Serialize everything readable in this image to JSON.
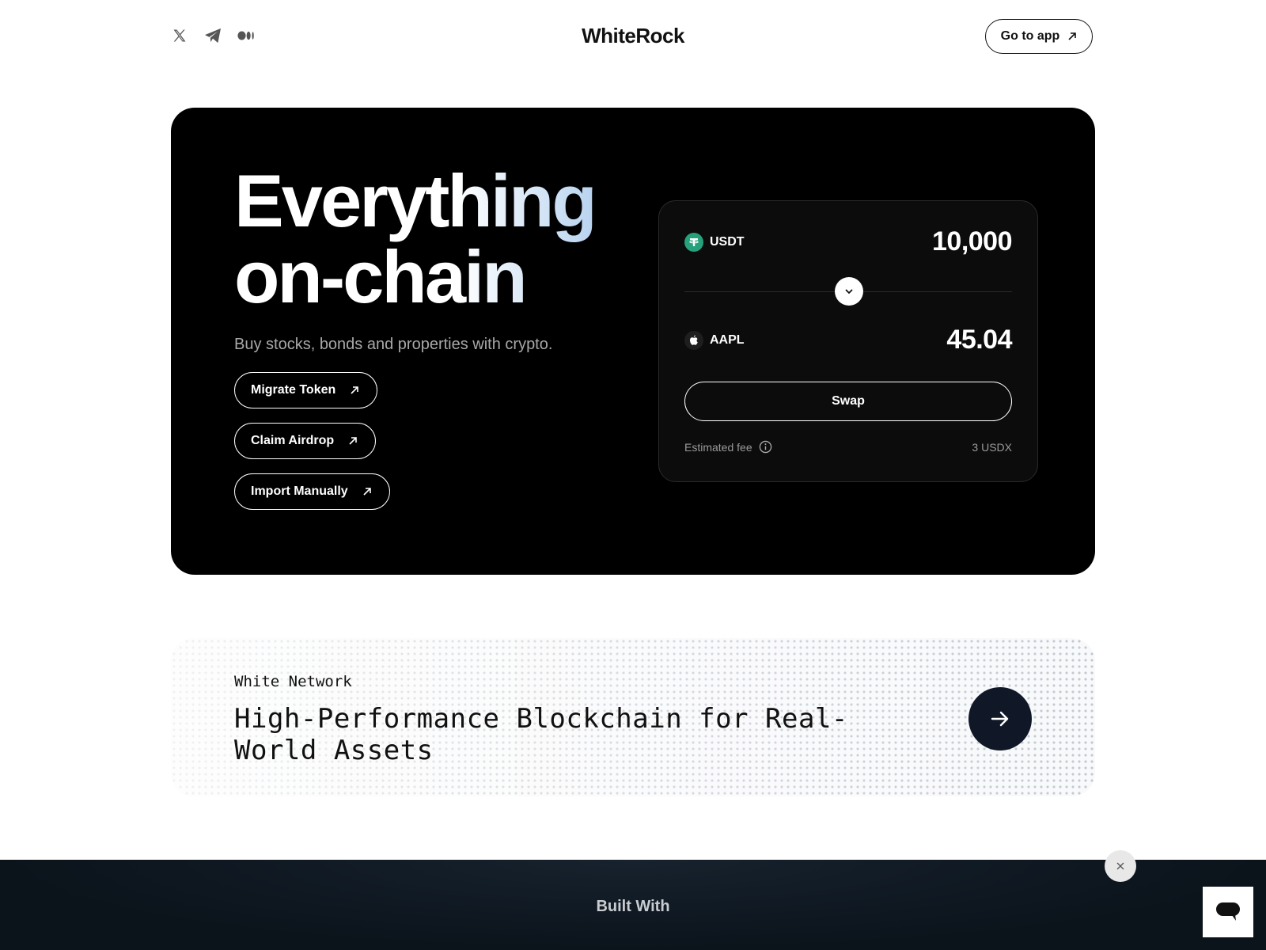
{
  "header": {
    "brand": "WhiteRock",
    "go_app_label": "Go to app",
    "socials": [
      "x-icon",
      "telegram-icon",
      "medium-icon"
    ]
  },
  "hero": {
    "headline_line1": "Everything",
    "headline_line2": "on-chain",
    "subtitle": "Buy stocks, bonds and properties with crypto.",
    "buttons": [
      "Migrate Token",
      "Claim Airdrop",
      "Import Manually"
    ]
  },
  "swap": {
    "from_token": "USDT",
    "from_amount": "10,000",
    "to_token": "AAPL",
    "to_amount": "45.04",
    "swap_label": "Swap",
    "fee_label": "Estimated fee",
    "fee_value": "3 USDX",
    "colors": {
      "usdt": "#26a17b"
    }
  },
  "network": {
    "label": "White Network",
    "title": "High-Performance Blockchain for Real-World Assets"
  },
  "built_with": {
    "title": "Built With"
  }
}
